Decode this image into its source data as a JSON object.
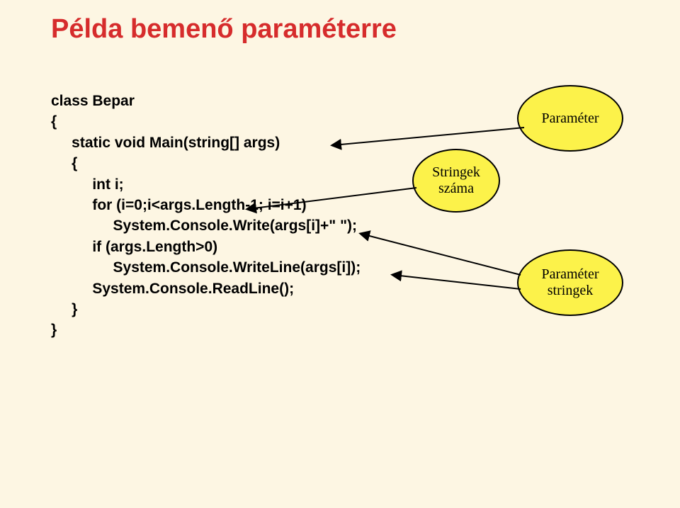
{
  "title": "Példa bemenő paraméterre",
  "code": {
    "l1": "class Bepar",
    "l2": "{",
    "l3": "     static void Main(string[] args)",
    "l4": "     {",
    "l5": "          int i;",
    "l6": "          for (i=0;i<args.Length-1; i=i+1)",
    "l7": "               System.Console.Write(args[i]+\" \");",
    "l8": "          if (args.Length>0)",
    "l9": "               System.Console.WriteLine(args[i]);",
    "l10": "          System.Console.ReadLine();",
    "l11": "     }",
    "l12": "}"
  },
  "bubbles": {
    "b1": "Paraméter",
    "b2_l1": "Stringek",
    "b2_l2": "száma",
    "b3_l1": "Paraméter",
    "b3_l2": "stringek"
  }
}
